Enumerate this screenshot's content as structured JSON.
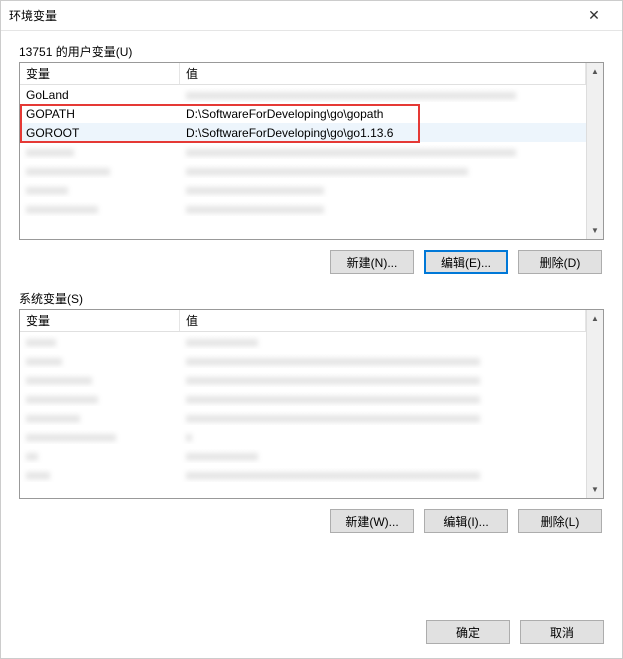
{
  "window": {
    "title": "环境变量"
  },
  "user_section": {
    "label": "13751 的用户变量(U)",
    "columns": {
      "variable": "变量",
      "value": "值"
    },
    "rows": [
      {
        "variable": "GoLand",
        "value": "",
        "blurred_value": true
      },
      {
        "variable": "GOPATH",
        "value": "D:\\SoftwareForDeveloping\\go\\gopath"
      },
      {
        "variable": "GOROOT",
        "value": "D:\\SoftwareForDeveloping\\go\\go1.13.6",
        "selected": true
      },
      {
        "variable": "",
        "value": "",
        "blurred_both": true
      },
      {
        "variable": "",
        "value": "",
        "blurred_both": true
      },
      {
        "variable": "",
        "value": "",
        "blurred_both": true
      },
      {
        "variable": "",
        "value": "",
        "blurred_both": true
      }
    ],
    "buttons": {
      "new": "新建(N)...",
      "edit": "编辑(E)...",
      "delete": "删除(D)"
    }
  },
  "system_section": {
    "label": "系统变量(S)",
    "columns": {
      "variable": "变量",
      "value": "值"
    },
    "rows": [
      {
        "blurred_both": true
      },
      {
        "blurred_both": true
      },
      {
        "blurred_both": true
      },
      {
        "blurred_both": true
      },
      {
        "blurred_both": true
      },
      {
        "blurred_both": true
      },
      {
        "blurred_both": true
      },
      {
        "blurred_both": true
      }
    ],
    "buttons": {
      "new": "新建(W)...",
      "edit": "编辑(I)...",
      "delete": "删除(L)"
    }
  },
  "dialog_buttons": {
    "ok": "确定",
    "cancel": "取消"
  }
}
